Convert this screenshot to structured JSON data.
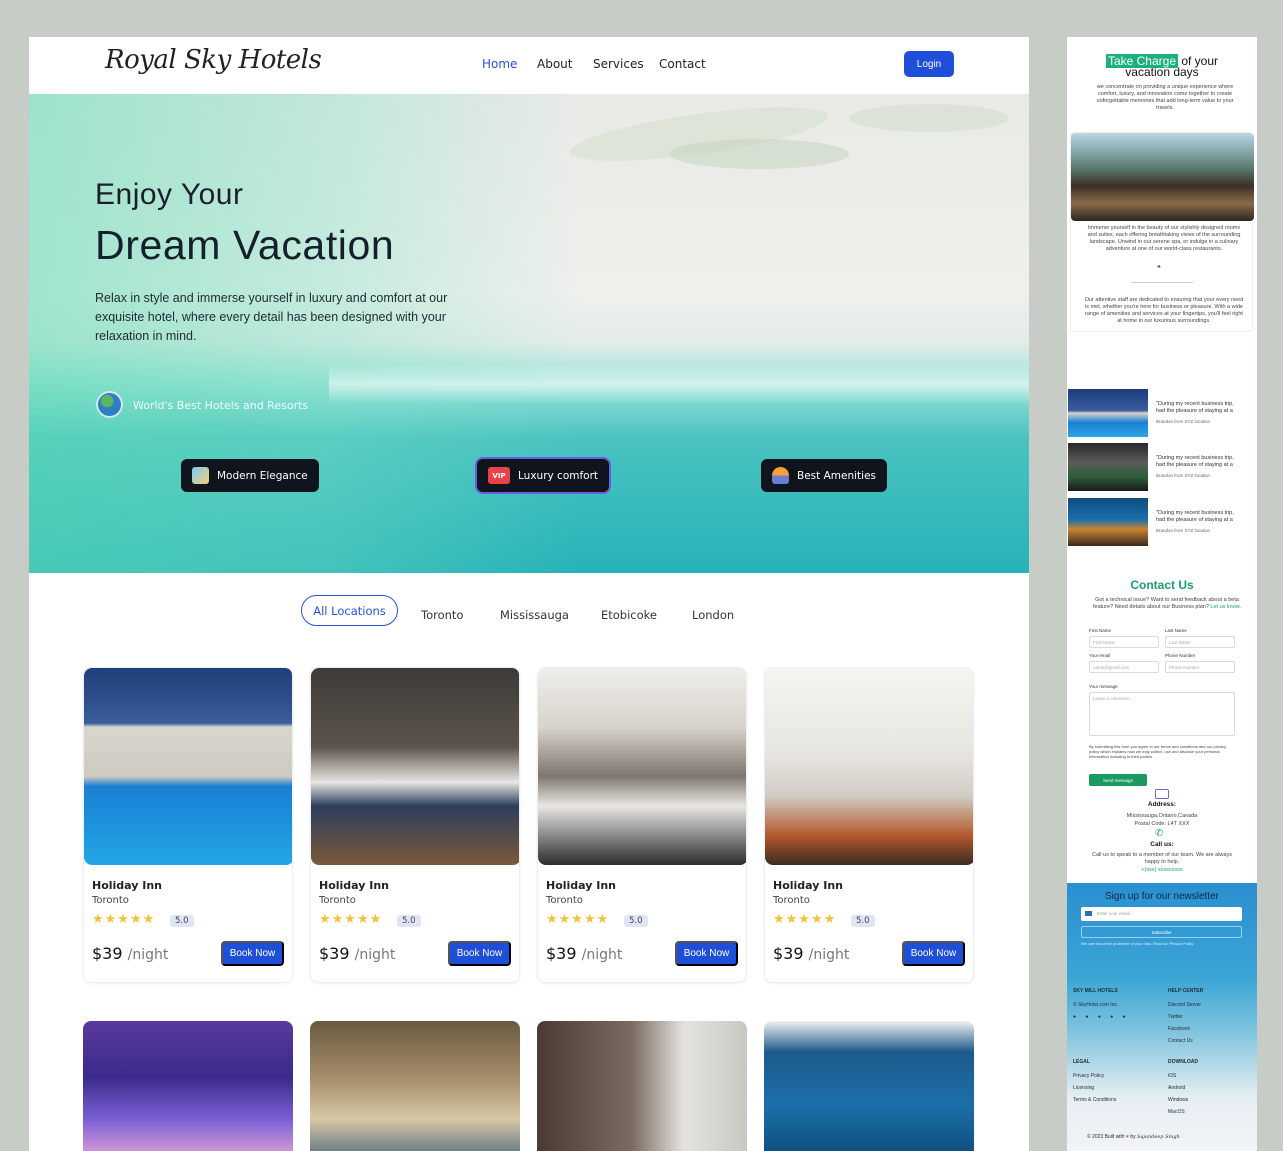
{
  "nav": {
    "logo": "Royal Sky Hotels",
    "links": [
      "Home",
      "About",
      "Services",
      "Contact"
    ],
    "login": "Login"
  },
  "hero": {
    "line1": "Enjoy Your",
    "line2": "Dream Vacation",
    "desc": "Relax in style and immerse yourself in luxury and comfort at our exquisite hotel, where every detail has been designed with your relaxation in mind.",
    "tagline": "World's Best Hotels and Resorts",
    "pills": [
      "Modern Elegance",
      "Luxury comfort",
      "Best Amenities"
    ],
    "vip": "VIP"
  },
  "locations": [
    "All Locations",
    "Toronto",
    "Mississauga",
    "Etobicoke",
    "London"
  ],
  "cards": [
    {
      "title": "Holiday Inn",
      "city": "Toronto",
      "stars": "★★★★★",
      "rating": "5.0",
      "price": "$39",
      "per": "/night",
      "cta": "Book Now"
    },
    {
      "title": "Holiday Inn",
      "city": "Toronto",
      "stars": "★★★★★",
      "rating": "5.0",
      "price": "$39",
      "per": "/night",
      "cta": "Book Now"
    },
    {
      "title": "Holiday Inn",
      "city": "Toronto",
      "stars": "★★★★★",
      "rating": "5.0",
      "price": "$39",
      "per": "/night",
      "cta": "Book Now"
    },
    {
      "title": "Holiday Inn",
      "city": "Toronto",
      "stars": "★★★★★",
      "rating": "5.0",
      "price": "$39",
      "per": "/night",
      "cta": "Book Now"
    }
  ],
  "side": {
    "tc_hl": "Take Charge",
    "tc_rest": " of your",
    "tc_l2": "vacation days",
    "tc_desc": "we concentrate on providing a unique experience where comfort, luxury, and innovation come together to create unforgettable memories that add long-term value to your travels.",
    "about_p1": "Immerse yourself in the beauty of our stylishly designed rooms and suites, each offering breathtaking views of the surrounding landscape. Unwind in our serene spa, or indulge in a culinary adventure at one of our world-class restaurants.",
    "quote_mark": "❝",
    "about_p2": "Our attentive staff are dedicated to ensuring that your every need is met, whether you're here for business or pleasure. With a wide range of amenities and services at your fingertips, you'll feel right at home in our luxurious surroundings.",
    "review_q1": "\"During my recent business trip,",
    "review_q2": "had the pleasure of staying at a",
    "review_a": "Brandon from XYZ location",
    "contact_title": "Contact Us",
    "contact_desc": "Got a technical issue? Want to send feedback about a beta feature? Need details about our Business plan?",
    "contact_link": "Let us know.",
    "first_name_label": "First Name",
    "first_name_ph": "First Name",
    "last_name_label": "Last Name",
    "last_name_ph": "Last Name",
    "email_label": "Your email",
    "email_ph": "name@gmail.com",
    "phone_label": "Phone Number",
    "phone_ph": "Phone Number",
    "msg_label": "Your message",
    "msg_ph": "Leave a comment...",
    "terms": "By submitting this form you agree to our terms and conditions and our privacy policy which explains how we may collect, use and disclose your personal information including to third parties.",
    "send": "Send message",
    "address_title": "Address:",
    "address": "Mississauga,Ontario,Canada",
    "postal": "Postal Code: L4T XXX",
    "call_title": "Call us:",
    "call_desc": "Call us to speak to a member of our team. We are always happy to help.",
    "phone": "+(xxx) xxxxxxxxx",
    "nl_title": "Sign up for our newsletter",
    "nl_ph": "Enter your email",
    "nl_btn": "Subscribe",
    "nl_note": "We care about the protection of your data. Read our Privacy Policy.",
    "f_col1": "SKY MILL HOTELS",
    "f_copy": "© SkyHotel.com Inc.",
    "f_col2": "HELP CENTER",
    "help": [
      "Discord Server",
      "Twitter",
      "Facebook",
      "Contact Us"
    ],
    "f_col3": "LEGAL",
    "legal": [
      "Privacy Policy",
      "Licensing",
      "Terms & Conditions"
    ],
    "f_col4": "DOWNLOAD",
    "download": [
      "iOS",
      "Android",
      "Windows",
      "MacOS"
    ],
    "built": "© 2023 Built with",
    "by": "by",
    "sign": "Sajandeep Singh"
  }
}
